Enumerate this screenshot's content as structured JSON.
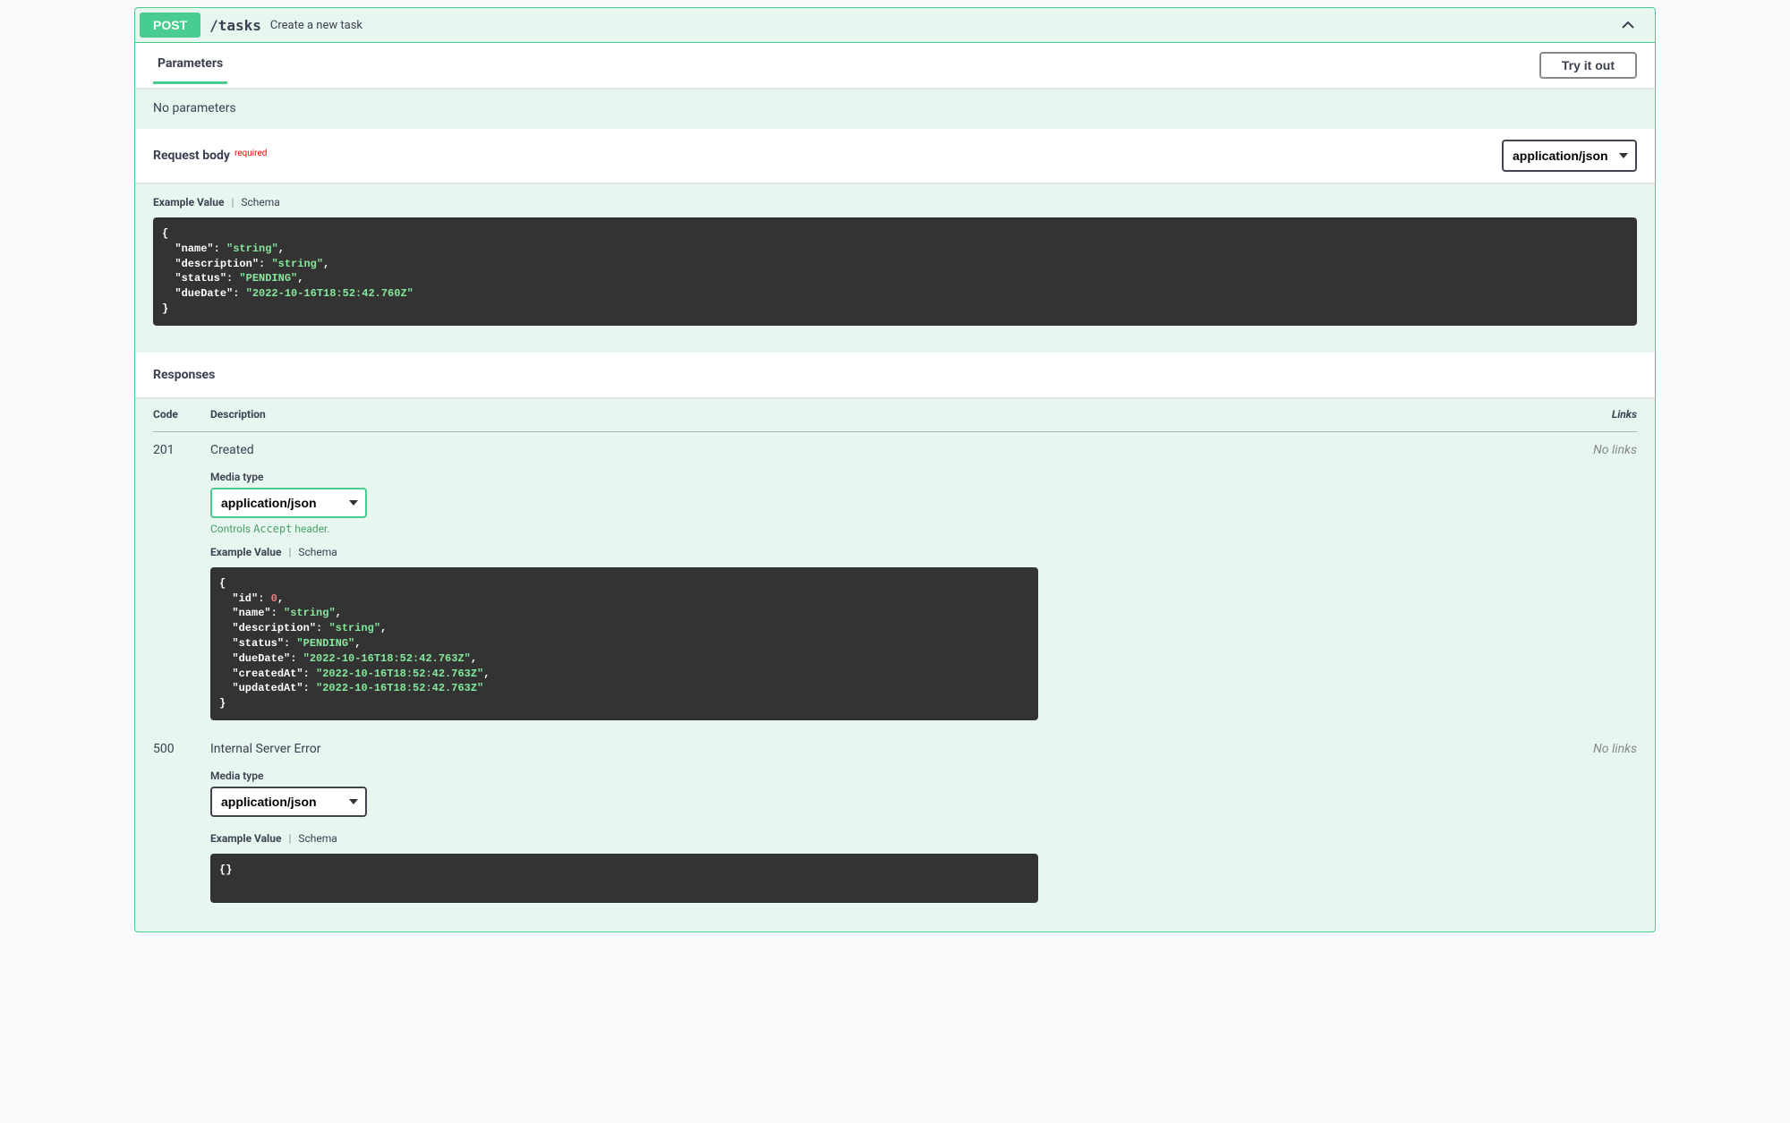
{
  "operation": {
    "method": "POST",
    "path": "/tasks",
    "summary": "Create a new task"
  },
  "parameters": {
    "tab_label": "Parameters",
    "try_out_label": "Try it out",
    "empty_message": "No parameters"
  },
  "request_body": {
    "label": "Request body",
    "required_badge": "required",
    "content_type": "application/json",
    "tabs": {
      "example": "Example Value",
      "schema": "Schema"
    }
  },
  "responses": {
    "header": "Responses",
    "columns": {
      "code": "Code",
      "description": "Description",
      "links": "Links"
    },
    "no_links": "No links",
    "media_type_label": "Media type",
    "accept_helper_prefix": "Controls ",
    "accept_helper_code": "Accept",
    "accept_helper_suffix": " header.",
    "items": [
      {
        "code": "201",
        "description": "Created",
        "media_type": "application/json",
        "show_accept_helper": true,
        "green_border": true
      },
      {
        "code": "500",
        "description": "Internal Server Error",
        "media_type": "application/json",
        "show_accept_helper": false,
        "green_border": false
      }
    ]
  },
  "chart_data": {
    "type": "table",
    "request_example": {
      "name": "string",
      "description": "string",
      "status": "PENDING",
      "dueDate": "2022-10-16T18:52:42.760Z"
    },
    "response_examples": {
      "201": {
        "id": 0,
        "name": "string",
        "description": "string",
        "status": "PENDING",
        "dueDate": "2022-10-16T18:52:42.763Z",
        "createdAt": "2022-10-16T18:52:42.763Z",
        "updatedAt": "2022-10-16T18:52:42.763Z"
      },
      "500": {}
    }
  }
}
